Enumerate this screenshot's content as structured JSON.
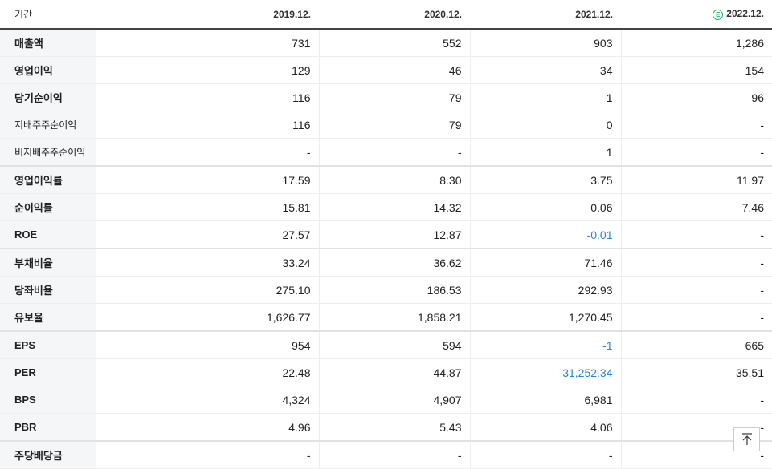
{
  "header": {
    "label": "기간",
    "periods": [
      "2019.12.",
      "2020.12.",
      "2021.12.",
      "2022.12."
    ],
    "estimate_marker": "E"
  },
  "rows": [
    {
      "label": "매출액",
      "values": [
        "731",
        "552",
        "903",
        "1,286"
      ]
    },
    {
      "label": "영업이익",
      "values": [
        "129",
        "46",
        "34",
        "154"
      ]
    },
    {
      "label": "당기순이익",
      "values": [
        "116",
        "79",
        "1",
        "96"
      ]
    },
    {
      "label": "지배주주순이익",
      "values": [
        "116",
        "79",
        "0",
        "-"
      ]
    },
    {
      "label": "비지배주주순이익",
      "values": [
        "-",
        "-",
        "1",
        "-"
      ]
    },
    {
      "label": "영업이익률",
      "values": [
        "17.59",
        "8.30",
        "3.75",
        "11.97"
      ]
    },
    {
      "label": "순이익률",
      "values": [
        "15.81",
        "14.32",
        "0.06",
        "7.46"
      ]
    },
    {
      "label": "ROE",
      "values": [
        "27.57",
        "12.87",
        "-0.01",
        "-"
      ]
    },
    {
      "label": "부채비율",
      "values": [
        "33.24",
        "36.62",
        "71.46",
        "-"
      ]
    },
    {
      "label": "당좌비율",
      "values": [
        "275.10",
        "186.53",
        "292.93",
        "-"
      ]
    },
    {
      "label": "유보율",
      "values": [
        "1,626.77",
        "1,858.21",
        "1,270.45",
        "-"
      ]
    },
    {
      "label": "EPS",
      "values": [
        "954",
        "594",
        "-1",
        "665"
      ]
    },
    {
      "label": "PER",
      "values": [
        "22.48",
        "44.87",
        "-31,252.34",
        "35.51"
      ]
    },
    {
      "label": "BPS",
      "values": [
        "4,324",
        "4,907",
        "6,981",
        "-"
      ]
    },
    {
      "label": "PBR",
      "values": [
        "4.96",
        "5.43",
        "4.06",
        "-"
      ]
    },
    {
      "label": "주당배당금",
      "values": [
        "-",
        "-",
        "-",
        "-"
      ]
    }
  ],
  "colors": {
    "negative": "#2a85d9",
    "estimate": "#1ab86a"
  }
}
